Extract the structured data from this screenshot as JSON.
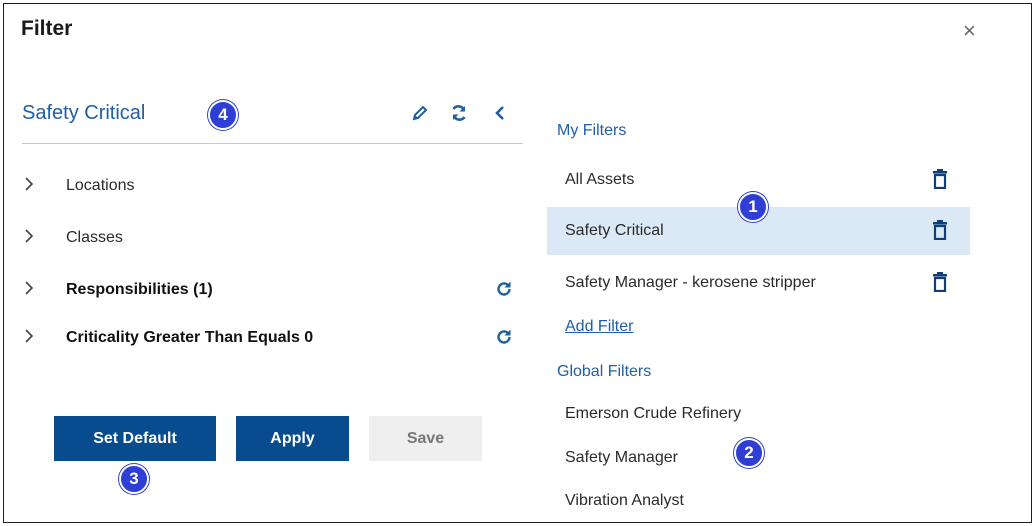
{
  "dialog": {
    "title": "Filter",
    "close_label": "×"
  },
  "left": {
    "filter_name": "Safety Critical",
    "badge": "4",
    "rows": [
      {
        "label": "Locations",
        "bold": false,
        "refresh": false
      },
      {
        "label": "Classes",
        "bold": false,
        "refresh": false
      },
      {
        "label": "Responsibilities (1)",
        "bold": true,
        "refresh": true
      },
      {
        "label": "Criticality Greater Than Equals 0",
        "bold": true,
        "refresh": true
      }
    ],
    "buttons": {
      "set_default": "Set Default",
      "apply": "Apply",
      "save": "Save"
    },
    "buttons_badge": "3"
  },
  "right": {
    "my_filters_title": "My Filters",
    "my_filters": [
      {
        "label": "All Assets",
        "selected": false
      },
      {
        "label": "Safety Critical",
        "selected": true
      },
      {
        "label": "Safety Manager - kerosene stripper",
        "selected": false
      }
    ],
    "my_filters_badge": "1",
    "add_filter": "Add Filter",
    "global_filters_title": "Global Filters",
    "global_filters": [
      "Emerson Crude Refinery",
      "Safety Manager",
      "Vibration Analyst"
    ],
    "global_filters_badge": "2"
  },
  "colors": {
    "accent": "#1f5fa3",
    "primary_button": "#064c8f",
    "selected_row": "#dbe8f6",
    "badge": "#2f3fd6"
  },
  "icons": [
    "pencil-icon",
    "sync-icon",
    "chevron-left-icon",
    "chevron-right-icon",
    "refresh-icon",
    "trash-icon",
    "close-icon"
  ]
}
